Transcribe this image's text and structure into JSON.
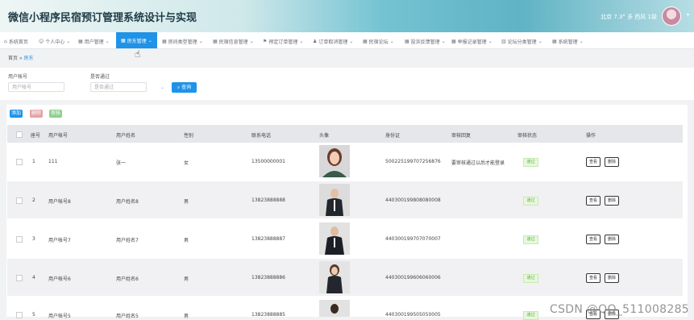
{
  "header": {
    "title": "微信小程序民宿预订管理系统设计与实现",
    "weather": "北京 7.3° 多 西风 1级"
  },
  "nav": [
    {
      "label": "系统首页",
      "icon": "home-icon"
    },
    {
      "label": "个人中心",
      "icon": "user-icon"
    },
    {
      "label": "用户管理",
      "icon": "grid-icon"
    },
    {
      "label": "房东管理",
      "icon": "grid-icon",
      "active": true
    },
    {
      "label": "房间类型管理",
      "icon": "grid-icon"
    },
    {
      "label": "民宿信息管理",
      "icon": "grid-icon"
    },
    {
      "label": "预定订单管理",
      "icon": "flag-icon"
    },
    {
      "label": "订单取消管理",
      "icon": "person-icon"
    },
    {
      "label": "民宿论坛",
      "icon": "grid-icon"
    },
    {
      "label": "投诉反馈管理",
      "icon": "grid-icon"
    },
    {
      "label": "举报记录管理",
      "icon": "grid-icon"
    },
    {
      "label": "论坛分类管理",
      "icon": "chart-icon"
    },
    {
      "label": "系统管理",
      "icon": "grid-icon"
    }
  ],
  "breadcrumb": {
    "home": "首页",
    "sep": "»",
    "current": "房东"
  },
  "search": {
    "account_label": "用户帐号",
    "account_placeholder": "用户帐号",
    "approved_label": "是否通过",
    "approved_placeholder": "是否通过",
    "query_button": "查询"
  },
  "toolbar": {
    "add": "添加",
    "delete": "删除",
    "review": "审核"
  },
  "table": {
    "headers": [
      "座号",
      "用户帐号",
      "用户姓名",
      "性别",
      "联系电话",
      "头像",
      "身份证",
      "审核回复",
      "审核状态",
      "操作"
    ],
    "rows": [
      {
        "index": "1",
        "account": "111",
        "name": "张一",
        "gender": "女",
        "phone": "13500000001",
        "id_card": "500225199707256876",
        "reply": "要审核通过以后才能登录",
        "status": "通过"
      },
      {
        "index": "2",
        "account": "用户帐号8",
        "name": "用户姓名8",
        "gender": "男",
        "phone": "13823888888",
        "id_card": "440300199808080008",
        "reply": "",
        "status": "通过"
      },
      {
        "index": "3",
        "account": "用户帐号7",
        "name": "用户姓名7",
        "gender": "男",
        "phone": "13823888887",
        "id_card": "440300199707070007",
        "reply": "",
        "status": "通过"
      },
      {
        "index": "4",
        "account": "用户帐号6",
        "name": "用户姓名6",
        "gender": "男",
        "phone": "13823888886",
        "id_card": "440300199606060006",
        "reply": "",
        "status": "通过"
      },
      {
        "index": "5",
        "account": "用户帐号5",
        "name": "用户姓名5",
        "gender": "男",
        "phone": "13823888885",
        "id_card": "440300199505050005",
        "reply": "",
        "status": "通过"
      }
    ],
    "view_button": "查看",
    "delete_button": "删除"
  },
  "watermark": "CSDN @QQ_511008285",
  "colors": {
    "accent": "#1e93e8",
    "add_button": "#1e93e8",
    "delete_button": "#e6a2a8",
    "review_button": "#8fd18c",
    "status_badge": "#58b53b"
  }
}
